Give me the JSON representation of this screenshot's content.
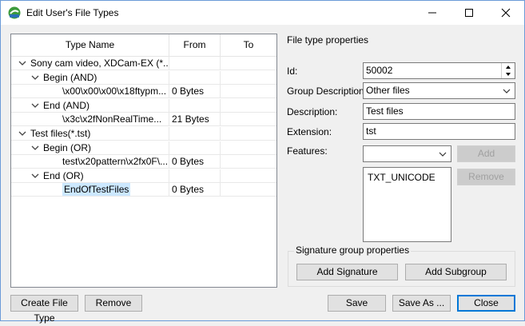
{
  "window": {
    "title": "Edit User's File Types"
  },
  "tree": {
    "headers": {
      "name": "Type Name",
      "from": "From",
      "to": "To"
    },
    "rows": [
      {
        "text": "Sony cam video, XDCam-EX (*...",
        "from": "",
        "to": "",
        "level": 0,
        "expander": "chevron-down"
      },
      {
        "text": "Begin (AND)",
        "from": "",
        "to": "",
        "level": 1,
        "expander": "chevron-down"
      },
      {
        "text": "\\x00\\x00\\x00\\x18ftypm...",
        "from": "0 Bytes",
        "to": "",
        "level": 2,
        "expander": ""
      },
      {
        "text": "End (AND)",
        "from": "",
        "to": "",
        "level": 1,
        "expander": "chevron-down"
      },
      {
        "text": "\\x3c\\x2fNonRealTime...",
        "from": "21 Bytes",
        "to": "",
        "level": 2,
        "expander": ""
      },
      {
        "text": "Test files(*.tst)",
        "from": "",
        "to": "",
        "level": 0,
        "expander": "chevron-down"
      },
      {
        "text": "Begin (OR)",
        "from": "",
        "to": "",
        "level": 1,
        "expander": "chevron-down"
      },
      {
        "text": "test\\x20pattern\\x2fx0F\\...",
        "from": "0 Bytes",
        "to": "",
        "level": 2,
        "expander": ""
      },
      {
        "text": "End (OR)",
        "from": "",
        "to": "",
        "level": 1,
        "expander": "chevron-down"
      },
      {
        "text": "EndOfTestFiles",
        "from": "0 Bytes",
        "to": "",
        "level": 2,
        "expander": "",
        "selected": true
      }
    ]
  },
  "props": {
    "section_title": "File type properties",
    "id_label": "Id:",
    "id_value": "50002",
    "group_desc_label": "Group Description:",
    "group_desc_value": "Other files",
    "description_label": "Description:",
    "description_value": "Test files",
    "extension_label": "Extension:",
    "extension_value": "tst",
    "features_label": "Features:",
    "features_value": "",
    "add_label": "Add",
    "remove_label": "Remove",
    "features_list": [
      "TXT_UNICODE"
    ]
  },
  "signature_group": {
    "title": "Signature group properties",
    "add_signature": "Add Signature",
    "add_subgroup": "Add Subgroup"
  },
  "footer": {
    "create_file_type": "Create File Type",
    "remove": "Remove",
    "save": "Save",
    "save_as": "Save As ...",
    "close": "Close"
  }
}
